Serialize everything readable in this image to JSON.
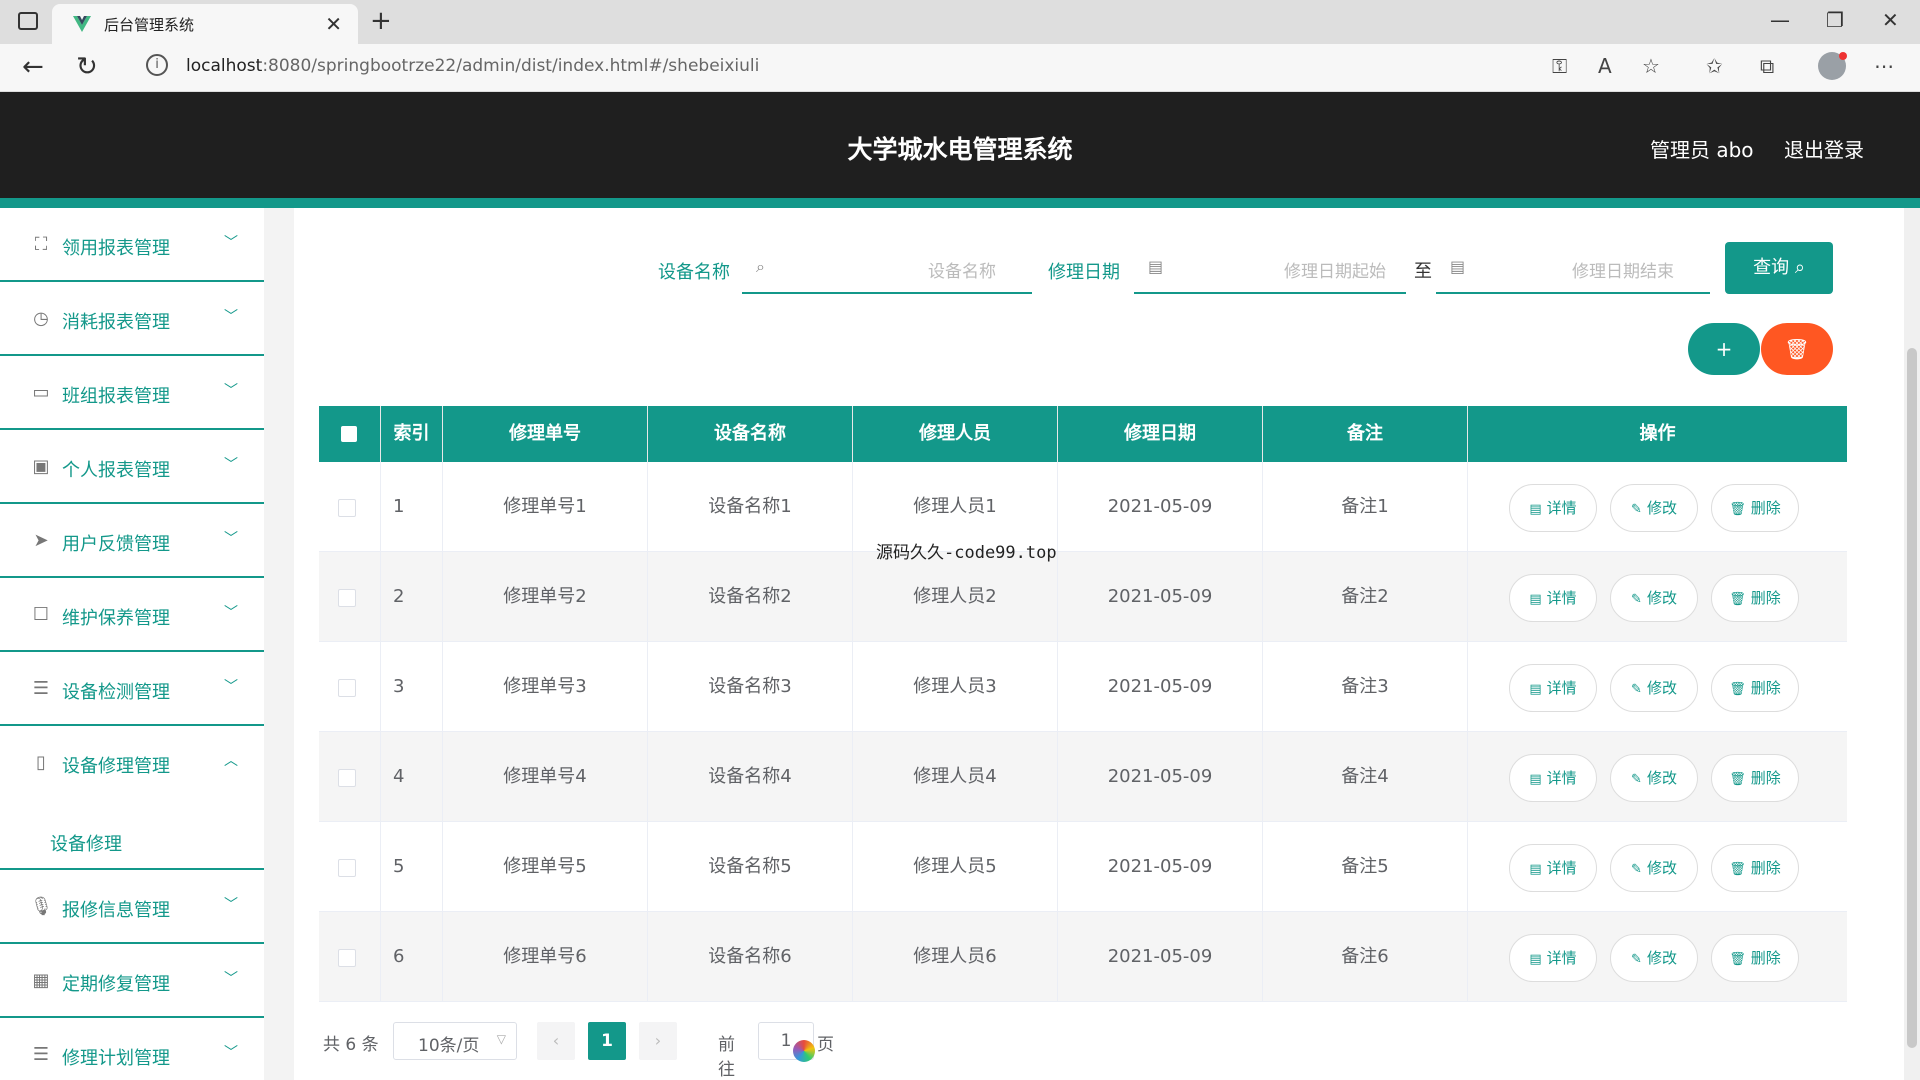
{
  "browser": {
    "tab_title": "后台管理系统",
    "url_host": "localhost",
    "url_path": ":8080/springbootrze22/admin/dist/index.html#/shebeixiuli"
  },
  "header": {
    "title": "大学城水电管理系统",
    "user": "管理员 abo",
    "logout": "退出登录"
  },
  "sidebar": {
    "items": [
      {
        "label": "领用报表管理",
        "icon": "frame-icon"
      },
      {
        "label": "消耗报表管理",
        "icon": "clock-icon"
      },
      {
        "label": "班组报表管理",
        "icon": "card-icon"
      },
      {
        "label": "个人报表管理",
        "icon": "clipboard-icon"
      },
      {
        "label": "用户反馈管理",
        "icon": "send-icon"
      },
      {
        "label": "维护保养管理",
        "icon": "square-icon"
      },
      {
        "label": "设备检测管理",
        "icon": "list-icon"
      },
      {
        "label": "设备修理管理",
        "icon": "phone-icon"
      },
      {
        "label": "报修信息管理",
        "icon": "mic-icon"
      },
      {
        "label": "定期修复管理",
        "icon": "grid-icon"
      },
      {
        "label": "修理计划管理",
        "icon": "list-icon"
      }
    ],
    "sub_item": "设备修理"
  },
  "filters": {
    "device_label": "设备名称",
    "device_placeholder": "设备名称",
    "date_label": "修理日期",
    "date_start_placeholder": "修理日期起始",
    "date_sep": "至",
    "date_end_placeholder": "修理日期结束",
    "query_button": "查询"
  },
  "actions": {
    "add": "+",
    "delete": "🗑"
  },
  "table": {
    "columns": [
      "索引",
      "修理单号",
      "设备名称",
      "修理人员",
      "修理日期",
      "备注",
      "操作"
    ],
    "rows": [
      {
        "index": "1",
        "no": "修理单号1",
        "device": "设备名称1",
        "person": "修理人员1",
        "date": "2021-05-09",
        "remark": "备注1"
      },
      {
        "index": "2",
        "no": "修理单号2",
        "device": "设备名称2",
        "person": "修理人员2",
        "date": "2021-05-09",
        "remark": "备注2"
      },
      {
        "index": "3",
        "no": "修理单号3",
        "device": "设备名称3",
        "person": "修理人员3",
        "date": "2021-05-09",
        "remark": "备注3"
      },
      {
        "index": "4",
        "no": "修理单号4",
        "device": "设备名称4",
        "person": "修理人员4",
        "date": "2021-05-09",
        "remark": "备注4"
      },
      {
        "index": "5",
        "no": "修理单号5",
        "device": "设备名称5",
        "person": "修理人员5",
        "date": "2021-05-09",
        "remark": "备注5"
      },
      {
        "index": "6",
        "no": "修理单号6",
        "device": "设备名称6",
        "person": "修理人员6",
        "date": "2021-05-09",
        "remark": "备注6"
      }
    ],
    "row_buttons": {
      "detail": "详情",
      "edit": "修改",
      "delete": "删除"
    }
  },
  "pagination": {
    "total": "共 6 条",
    "page_size": "10条/页",
    "current": "1",
    "goto_label": "前往",
    "goto_value": "1",
    "page_suffix": "页"
  },
  "overlay_text": "源码久久-code99.top",
  "colors": {
    "accent": "#13988a",
    "danger": "#ff5722",
    "header_bg": "#1f1f1f"
  }
}
